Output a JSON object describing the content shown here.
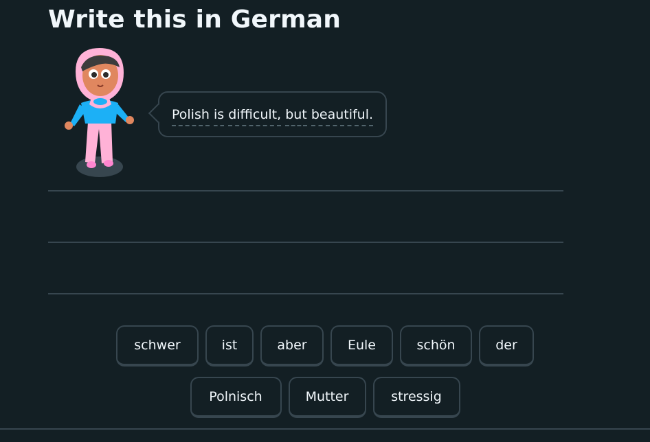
{
  "header": {
    "title": "Write this in German"
  },
  "prompt": {
    "words": [
      "Polish",
      "is",
      "difficult,",
      "but",
      "beautiful."
    ],
    "separators": [
      " ",
      " ",
      " ",
      " ",
      ""
    ]
  },
  "word_bank": {
    "row1": [
      "schwer",
      "ist",
      "aber",
      "Eule",
      "schön",
      "der"
    ],
    "row2": [
      "Polnisch",
      "Mutter",
      "stressig"
    ]
  },
  "colors": {
    "background": "#131f24",
    "border": "#37464f",
    "text": "#f1f7fb",
    "character_hijab": "#ffb2d7",
    "character_top": "#1cb0f6"
  }
}
